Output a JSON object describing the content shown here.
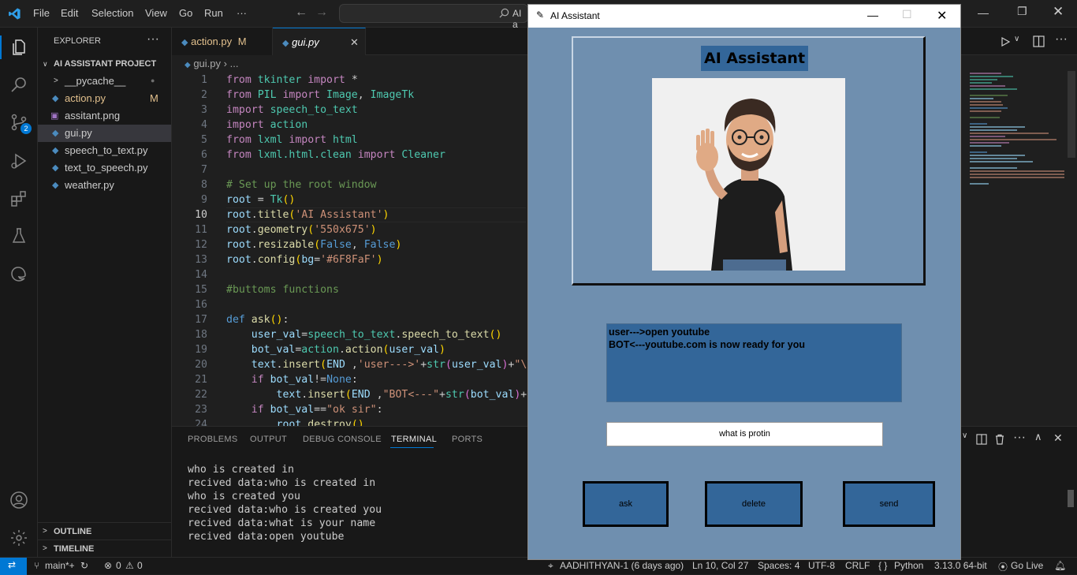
{
  "menubar": {
    "items": [
      "File",
      "Edit",
      "Selection",
      "View",
      "Go",
      "Run",
      "···"
    ],
    "search_fragment": "AI a"
  },
  "sidebar": {
    "header": "EXPLORER",
    "project": "AI ASSISTANT PROJECT",
    "items": [
      {
        "label": "__pycache__",
        "kind": "folder",
        "badge": ""
      },
      {
        "label": "action.py",
        "kind": "python",
        "badge": "M"
      },
      {
        "label": "assitant.png",
        "kind": "image",
        "badge": ""
      },
      {
        "label": "gui.py",
        "kind": "python",
        "badge": ""
      },
      {
        "label": "speech_to_text.py",
        "kind": "python",
        "badge": ""
      },
      {
        "label": "text_to_speech.py",
        "kind": "python",
        "badge": ""
      },
      {
        "label": "weather.py",
        "kind": "python",
        "badge": ""
      }
    ],
    "outline": "OUTLINE",
    "timeline": "TIMELINE",
    "scm_badge": "2"
  },
  "editor": {
    "tabs": [
      {
        "label": "action.py",
        "badge": "M"
      },
      {
        "label": "gui.py",
        "badge": ""
      }
    ],
    "breadcrumb": [
      "gui.py",
      "..."
    ]
  },
  "code_lines": [
    {
      "n": "1",
      "tokens": [
        [
          "kw",
          "from "
        ],
        [
          "mod",
          "tkinter "
        ],
        [
          "kw",
          "import "
        ],
        [
          "pl",
          "*"
        ]
      ]
    },
    {
      "n": "2",
      "tokens": [
        [
          "kw",
          "from "
        ],
        [
          "mod",
          "PIL "
        ],
        [
          "kw",
          "import "
        ],
        [
          "cls",
          "Image"
        ],
        [
          "pl",
          ", "
        ],
        [
          "cls",
          "ImageTk"
        ]
      ]
    },
    {
      "n": "3",
      "tokens": [
        [
          "kw",
          "import "
        ],
        [
          "mod",
          "speech_to_text"
        ]
      ]
    },
    {
      "n": "4",
      "tokens": [
        [
          "kw",
          "import "
        ],
        [
          "mod",
          "action"
        ]
      ]
    },
    {
      "n": "5",
      "tokens": [
        [
          "kw",
          "from "
        ],
        [
          "mod",
          "lxml "
        ],
        [
          "kw",
          "import "
        ],
        [
          "mod",
          "html"
        ]
      ]
    },
    {
      "n": "6",
      "tokens": [
        [
          "kw",
          "from "
        ],
        [
          "mod",
          "lxml.html.clean "
        ],
        [
          "kw",
          "import "
        ],
        [
          "cls",
          "Cleaner"
        ]
      ]
    },
    {
      "n": "7",
      "tokens": []
    },
    {
      "n": "8",
      "tokens": [
        [
          "cm",
          "# Set up the root window"
        ]
      ]
    },
    {
      "n": "9",
      "tokens": [
        [
          "var",
          "root "
        ],
        [
          "pl",
          "= "
        ],
        [
          "cls",
          "Tk"
        ],
        [
          "br",
          "()"
        ]
      ]
    },
    {
      "n": "10",
      "tokens": [
        [
          "var",
          "root"
        ],
        [
          "pl",
          "."
        ],
        [
          "fn",
          "title"
        ],
        [
          "br",
          "("
        ],
        [
          "str",
          "'AI Assistant'"
        ],
        [
          "br",
          ")"
        ]
      ]
    },
    {
      "n": "11",
      "tokens": [
        [
          "var",
          "root"
        ],
        [
          "pl",
          "."
        ],
        [
          "fn",
          "geometry"
        ],
        [
          "br",
          "("
        ],
        [
          "str",
          "'550x675'"
        ],
        [
          "br",
          ")"
        ]
      ]
    },
    {
      "n": "12",
      "tokens": [
        [
          "var",
          "root"
        ],
        [
          "pl",
          "."
        ],
        [
          "fn",
          "resizable"
        ],
        [
          "br",
          "("
        ],
        [
          "kb",
          "False"
        ],
        [
          "pl",
          ", "
        ],
        [
          "kb",
          "False"
        ],
        [
          "br",
          ")"
        ]
      ]
    },
    {
      "n": "13",
      "tokens": [
        [
          "var",
          "root"
        ],
        [
          "pl",
          "."
        ],
        [
          "fn",
          "config"
        ],
        [
          "br",
          "("
        ],
        [
          "var",
          "bg"
        ],
        [
          "pl",
          "="
        ],
        [
          "str",
          "'#6F8FaF'"
        ],
        [
          "br",
          ")"
        ]
      ]
    },
    {
      "n": "14",
      "tokens": []
    },
    {
      "n": "15",
      "tokens": [
        [
          "cm",
          "#buttoms functions"
        ]
      ]
    },
    {
      "n": "16",
      "tokens": []
    },
    {
      "n": "17",
      "tokens": [
        [
          "kb",
          "def "
        ],
        [
          "fn",
          "ask"
        ],
        [
          "br",
          "()"
        ],
        [
          "pl",
          ":"
        ]
      ]
    },
    {
      "n": "18",
      "tokens": [
        [
          "pl",
          "    "
        ],
        [
          "var",
          "user_val"
        ],
        [
          "pl",
          "="
        ],
        [
          "mod",
          "speech_to_text"
        ],
        [
          "pl",
          "."
        ],
        [
          "fn",
          "speech_to_text"
        ],
        [
          "br",
          "()"
        ]
      ]
    },
    {
      "n": "19",
      "tokens": [
        [
          "pl",
          "    "
        ],
        [
          "var",
          "bot_val"
        ],
        [
          "pl",
          "="
        ],
        [
          "mod",
          "action"
        ],
        [
          "pl",
          "."
        ],
        [
          "fn",
          "action"
        ],
        [
          "br",
          "("
        ],
        [
          "var",
          "user_val"
        ],
        [
          "br",
          ")"
        ]
      ]
    },
    {
      "n": "20",
      "tokens": [
        [
          "pl",
          "    "
        ],
        [
          "var",
          "text"
        ],
        [
          "pl",
          "."
        ],
        [
          "fn",
          "insert"
        ],
        [
          "br",
          "("
        ],
        [
          "var",
          "END "
        ],
        [
          "pl",
          ","
        ],
        [
          "str",
          "'user--->'"
        ],
        [
          "pl",
          "+"
        ],
        [
          "cls",
          "str"
        ],
        [
          "br2",
          "("
        ],
        [
          "var",
          "user_val"
        ],
        [
          "br2",
          ")"
        ],
        [
          "pl",
          "+"
        ],
        [
          "str",
          "\"\\"
        ]
      ]
    },
    {
      "n": "21",
      "tokens": [
        [
          "pl",
          "    "
        ],
        [
          "kw",
          "if "
        ],
        [
          "var",
          "bot_val"
        ],
        [
          "pl",
          "!="
        ],
        [
          "kb",
          "None"
        ],
        [
          "pl",
          ":"
        ]
      ]
    },
    {
      "n": "22",
      "tokens": [
        [
          "pl",
          "        "
        ],
        [
          "var",
          "text"
        ],
        [
          "pl",
          "."
        ],
        [
          "fn",
          "insert"
        ],
        [
          "br",
          "("
        ],
        [
          "var",
          "END "
        ],
        [
          "pl",
          ","
        ],
        [
          "str",
          "\"BOT<---\""
        ],
        [
          "pl",
          "+"
        ],
        [
          "cls",
          "str"
        ],
        [
          "br2",
          "("
        ],
        [
          "var",
          "bot_val"
        ],
        [
          "br2",
          ")"
        ],
        [
          "pl",
          "+"
        ]
      ]
    },
    {
      "n": "23",
      "tokens": [
        [
          "pl",
          "    "
        ],
        [
          "kw",
          "if "
        ],
        [
          "var",
          "bot_val"
        ],
        [
          "pl",
          "=="
        ],
        [
          "str",
          "\"ok sir\""
        ],
        [
          "pl",
          ":"
        ]
      ]
    },
    {
      "n": "24",
      "tokens": [
        [
          "pl",
          "        "
        ],
        [
          "var",
          "root"
        ],
        [
          "pl",
          "."
        ],
        [
          "fn",
          "destroy"
        ],
        [
          "br",
          "()"
        ]
      ]
    }
  ],
  "panel": {
    "tabs": [
      "PROBLEMS",
      "OUTPUT",
      "DEBUG CONSOLE",
      "TERMINAL",
      "PORTS"
    ],
    "active_tab": "TERMINAL",
    "terminal_lines": [
      "who is created in",
      "recived data:who is created in",
      "who is created you",
      "recived data:who is created you",
      "recived data:what is your name",
      "recived data:open youtube"
    ]
  },
  "statusbar": {
    "branch": "main*+",
    "errors": "0",
    "warnings": "0",
    "commit": "AADHITHYAN-1 (6 days ago)",
    "position": "Ln 10, Col 27",
    "spaces": "Spaces: 4",
    "encoding": "UTF-8",
    "eol": "CRLF",
    "language": "Python",
    "interpreter": "3.13.0 64-bit",
    "golive": "Go Live"
  },
  "tk": {
    "window_title": "AI Assistant",
    "heading": "AI Assistant",
    "chat_lines": [
      "user--->open youtube",
      "BOT<---youtube.com is now ready for you"
    ],
    "entry_value": "what is protin",
    "buttons": [
      "ask",
      "delete",
      "send"
    ],
    "bg": "#6F8FAF",
    "accent": "#336699"
  }
}
